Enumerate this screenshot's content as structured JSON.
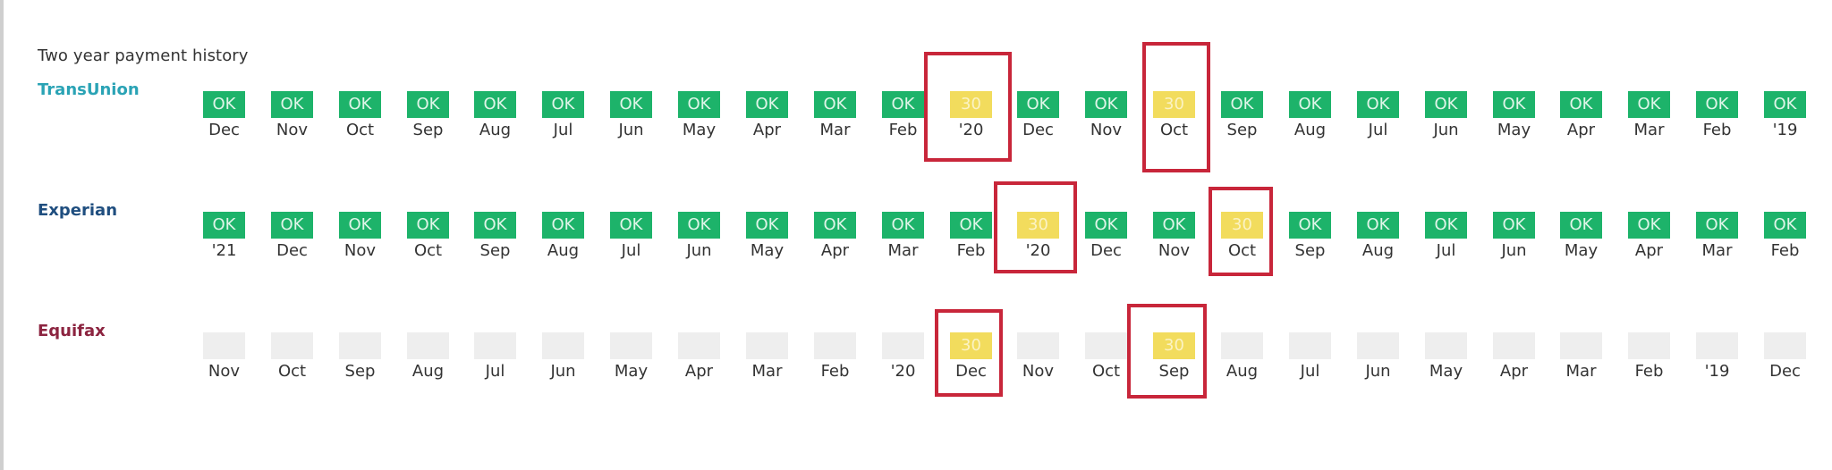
{
  "title": "Two year payment history",
  "colors": {
    "ok": "#1db36a",
    "late": "#f2dc5d",
    "empty": "#eeeeee",
    "highlight": "#c8263a",
    "transunion": "#2aa3b5",
    "experian": "#1f4e7f",
    "equifax": "#8c2440"
  },
  "bureaus": [
    {
      "name": "TransUnion",
      "color": "#2aa3b5",
      "cells": [
        {
          "status": "OK",
          "month": "Dec"
        },
        {
          "status": "OK",
          "month": "Nov"
        },
        {
          "status": "OK",
          "month": "Oct"
        },
        {
          "status": "OK",
          "month": "Sep"
        },
        {
          "status": "OK",
          "month": "Aug"
        },
        {
          "status": "OK",
          "month": "Jul"
        },
        {
          "status": "OK",
          "month": "Jun"
        },
        {
          "status": "OK",
          "month": "May"
        },
        {
          "status": "OK",
          "month": "Apr"
        },
        {
          "status": "OK",
          "month": "Mar"
        },
        {
          "status": "OK",
          "month": "Feb"
        },
        {
          "status": "30",
          "month": "'20",
          "highlighted": true
        },
        {
          "status": "OK",
          "month": "Dec"
        },
        {
          "status": "OK",
          "month": "Nov"
        },
        {
          "status": "30",
          "month": "Oct",
          "highlighted": true
        },
        {
          "status": "OK",
          "month": "Sep"
        },
        {
          "status": "OK",
          "month": "Aug"
        },
        {
          "status": "OK",
          "month": "Jul"
        },
        {
          "status": "OK",
          "month": "Jun"
        },
        {
          "status": "OK",
          "month": "May"
        },
        {
          "status": "OK",
          "month": "Apr"
        },
        {
          "status": "OK",
          "month": "Mar"
        },
        {
          "status": "OK",
          "month": "Feb"
        },
        {
          "status": "OK",
          "month": "'19"
        }
      ]
    },
    {
      "name": "Experian",
      "color": "#1f4e7f",
      "cells": [
        {
          "status": "OK",
          "month": "'21"
        },
        {
          "status": "OK",
          "month": "Dec"
        },
        {
          "status": "OK",
          "month": "Nov"
        },
        {
          "status": "OK",
          "month": "Oct"
        },
        {
          "status": "OK",
          "month": "Sep"
        },
        {
          "status": "OK",
          "month": "Aug"
        },
        {
          "status": "OK",
          "month": "Jul"
        },
        {
          "status": "OK",
          "month": "Jun"
        },
        {
          "status": "OK",
          "month": "May"
        },
        {
          "status": "OK",
          "month": "Apr"
        },
        {
          "status": "OK",
          "month": "Mar"
        },
        {
          "status": "OK",
          "month": "Feb"
        },
        {
          "status": "30",
          "month": "'20",
          "highlighted": true
        },
        {
          "status": "OK",
          "month": "Dec"
        },
        {
          "status": "OK",
          "month": "Nov"
        },
        {
          "status": "30",
          "month": "Oct",
          "highlighted": true
        },
        {
          "status": "OK",
          "month": "Sep"
        },
        {
          "status": "OK",
          "month": "Aug"
        },
        {
          "status": "OK",
          "month": "Jul"
        },
        {
          "status": "OK",
          "month": "Jun"
        },
        {
          "status": "OK",
          "month": "May"
        },
        {
          "status": "OK",
          "month": "Apr"
        },
        {
          "status": "OK",
          "month": "Mar"
        },
        {
          "status": "OK",
          "month": "Feb"
        }
      ]
    },
    {
      "name": "Equifax",
      "color": "#8c2440",
      "cells": [
        {
          "status": "",
          "month": "Nov"
        },
        {
          "status": "",
          "month": "Oct"
        },
        {
          "status": "",
          "month": "Sep"
        },
        {
          "status": "",
          "month": "Aug"
        },
        {
          "status": "",
          "month": "Jul"
        },
        {
          "status": "",
          "month": "Jun"
        },
        {
          "status": "",
          "month": "May"
        },
        {
          "status": "",
          "month": "Apr"
        },
        {
          "status": "",
          "month": "Mar"
        },
        {
          "status": "",
          "month": "Feb"
        },
        {
          "status": "",
          "month": "'20"
        },
        {
          "status": "30",
          "month": "Dec",
          "highlighted": true
        },
        {
          "status": "",
          "month": "Nov"
        },
        {
          "status": "",
          "month": "Oct"
        },
        {
          "status": "30",
          "month": "Sep",
          "highlighted": true
        },
        {
          "status": "",
          "month": "Aug"
        },
        {
          "status": "",
          "month": "Jul"
        },
        {
          "status": "",
          "month": "Jun"
        },
        {
          "status": "",
          "month": "May"
        },
        {
          "status": "",
          "month": "Apr"
        },
        {
          "status": "",
          "month": "Mar"
        },
        {
          "status": "",
          "month": "Feb"
        },
        {
          "status": "",
          "month": "'19"
        },
        {
          "status": "",
          "month": "Dec"
        }
      ]
    }
  ]
}
